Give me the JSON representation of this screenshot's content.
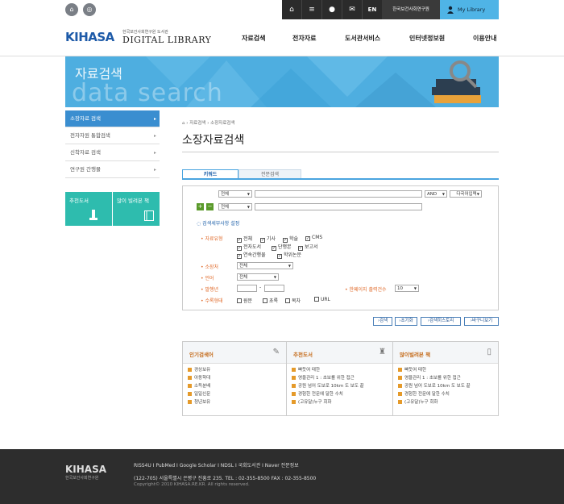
{
  "topbar": {
    "lang": "EN",
    "institute": "한국보건사회연구원",
    "mylibrary": "My Library"
  },
  "header": {
    "logo": "KIHASA",
    "logo_sub": "한국보건사회연구원 도서관",
    "logo_title": "DIGITAL LIBRARY",
    "nav": [
      "자료검색",
      "전자자료",
      "도서관서비스",
      "인터넷정보원",
      "이용안내"
    ]
  },
  "banner": {
    "title": "자료검색",
    "watermark": "data search"
  },
  "sidebar": {
    "items": [
      "소장자료 검색",
      "전자자원 통합검색",
      "신착자료 검색",
      "연구원 간행물"
    ],
    "box1": "추천도서",
    "box2": "많이 빌려본 책"
  },
  "breadcrumb": {
    "items": [
      "자료검색",
      "소장자료검색"
    ]
  },
  "page": {
    "title": "소장자료검색"
  },
  "tabs": [
    "키워드",
    "전문검색"
  ],
  "form": {
    "row1_field": "전체",
    "row1_op": "AND",
    "row1_btn": "다국어입력",
    "row2_field": "전체",
    "detail_toggle": "검색세부사항 설정",
    "material_label": "자료유형",
    "material_options": [
      "전체",
      "기사",
      "학술",
      "CMS",
      "전자도서",
      "단행본",
      "보고서",
      "연속간행물",
      "학위논문"
    ],
    "location_label": "소장처",
    "location_value": "전체",
    "language_label": "언어",
    "language_value": "전체",
    "year_label": "발행년",
    "year_sep": "-",
    "count_label": "한페이지 출력건수",
    "count_value": "10",
    "tag_label": "수록형태",
    "tag_options": [
      "원문",
      "초록",
      "목차",
      "URL"
    ]
  },
  "buttons": [
    "검색",
    "초기화",
    "검색히스토리",
    "바구니보기"
  ],
  "panels": [
    {
      "title": "인기검색어",
      "items": [
        "경상보유",
        "아동학대",
        "소득분배",
        "일일신문",
        "청년보유"
      ]
    },
    {
      "title": "추천도서",
      "items": [
        "빠듯여 태한",
        "영을관리 1 : 초보를 위한 접근",
        "공원 넘어 도보로 10km 도 보도 끝",
        "경험한 전문에 달한 수치",
        "(고유달)누구 회화"
      ]
    },
    {
      "title": "많이빌려본 책",
      "items": [
        "빠듯여 태한",
        "영을관리 1 : 초보를 위한 접근",
        "공원 넘어 도보로 10km 도 보도 끝",
        "경험한 전문에 달한 수치",
        "(고유달)누구 회화"
      ]
    }
  ],
  "footer": {
    "logo": "KIHASA",
    "logo_sub": "한국보건사회연구원",
    "links": "RISS4U  I  PubMed  I  Google Scholar  I  NDSL  I  국회도서관  I  Naver 전문정보",
    "address": "(122-705) 서울특별시 은평구 진흥로 235.     TEL : 02-355-8500      FAX : 02-355-8500",
    "copyright": "Copyright© 2010 KIHASA.RE.KR.   All rights reserved."
  }
}
